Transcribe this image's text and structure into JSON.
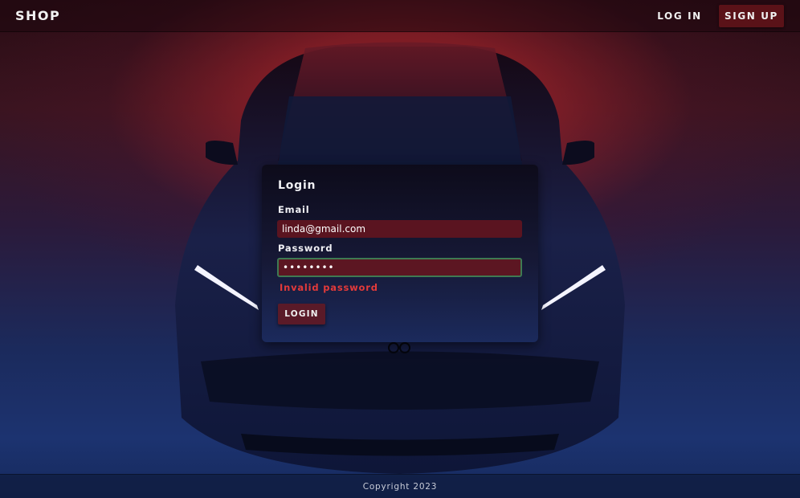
{
  "header": {
    "brand": "SHOP",
    "login_label": "LOG IN",
    "signup_label": "SIGN UP"
  },
  "login_form": {
    "title": "Login",
    "email_label": "Email",
    "email_value": "linda@gmail.com",
    "password_label": "Password",
    "password_value": "password",
    "error_message": "Invalid password",
    "submit_label": "LOGIN"
  },
  "footer": {
    "copyright": "Copyright 2023"
  },
  "colors": {
    "accent": "#5a1218",
    "error": "#e43a3a",
    "focus_border": "#3f7a52"
  }
}
